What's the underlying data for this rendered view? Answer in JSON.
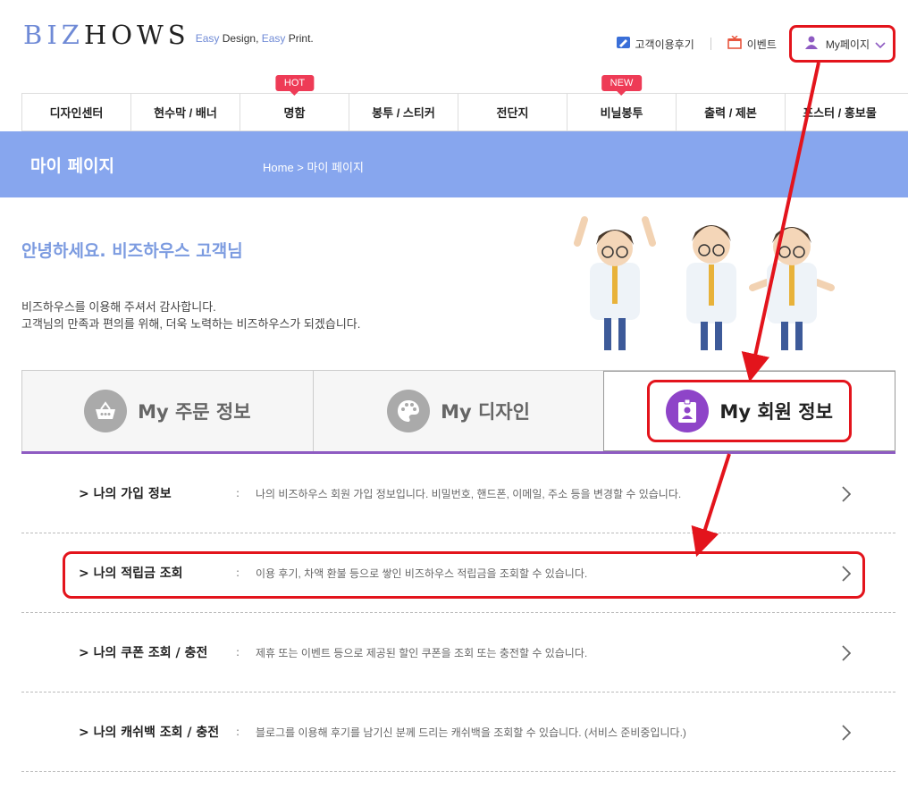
{
  "header": {
    "logo_main": "BIZHOWS",
    "logo_tag_easy1": "Easy",
    "logo_tag_design": " Design, ",
    "logo_tag_easy2": "Easy",
    "logo_tag_print": " Print.",
    "links": {
      "review": "고객이용후기",
      "event": "이벤트",
      "mypage": "My페이지"
    }
  },
  "nav": {
    "items": [
      {
        "label": "디자인센터",
        "badge": ""
      },
      {
        "label": "현수막 / 배너",
        "badge": ""
      },
      {
        "label": "명함",
        "badge": "HOT"
      },
      {
        "label": "봉투 / 스티커",
        "badge": ""
      },
      {
        "label": "전단지",
        "badge": ""
      },
      {
        "label": "비닐봉투",
        "badge": "NEW"
      },
      {
        "label": "출력 / 제본",
        "badge": ""
      },
      {
        "label": "포스터 / 홍보물",
        "badge": ""
      }
    ]
  },
  "banner": {
    "title": "마이 페이지",
    "breadcrumb": "Home > 마이 페이지"
  },
  "greeting": {
    "headline": "안녕하세요. 비즈하우스 고객님",
    "line1": "비즈하우스를 이용해 주셔서 감사합니다.",
    "line2": "고객님의 만족과 편의를 위해, 더욱 노력하는 비즈하우스가 되겠습니다."
  },
  "tabs": [
    {
      "label": "My 주문 정보",
      "icon": "basket-icon",
      "active": false
    },
    {
      "label": "My 디자인",
      "icon": "palette-icon",
      "active": false
    },
    {
      "label": "My 회원 정보",
      "icon": "member-badge-icon",
      "active": true
    }
  ],
  "list": [
    {
      "title": "나의 가입 정보",
      "desc": "나의 비즈하우스 회원 가입 정보입니다. 비밀번호, 핸드폰, 이메일, 주소 등을 변경할 수 있습니다."
    },
    {
      "title": "나의 적립금 조회",
      "desc": "이용 후기, 차액 환불 등으로 쌓인 비즈하우스 적립금을 조회할 수 있습니다."
    },
    {
      "title": "나의 쿠폰 조회 / 충전",
      "desc": "제휴 또는 이벤트 등으로 제공된 할인 쿠폰을 조회 또는 충전할 수 있습니다."
    },
    {
      "title": "나의 캐쉬백 조회 / 충전",
      "desc": "블로그를 이용해 후기를 남기신 분께 드리는 캐쉬백을 조회할 수 있습니다. (서비스 준비중입니다.)"
    }
  ],
  "list_prefix": ">",
  "list_colon": ":",
  "colors": {
    "brand": "#87a6ee",
    "accent_purple": "#8e44c8",
    "annotation_red": "#e3141c"
  }
}
